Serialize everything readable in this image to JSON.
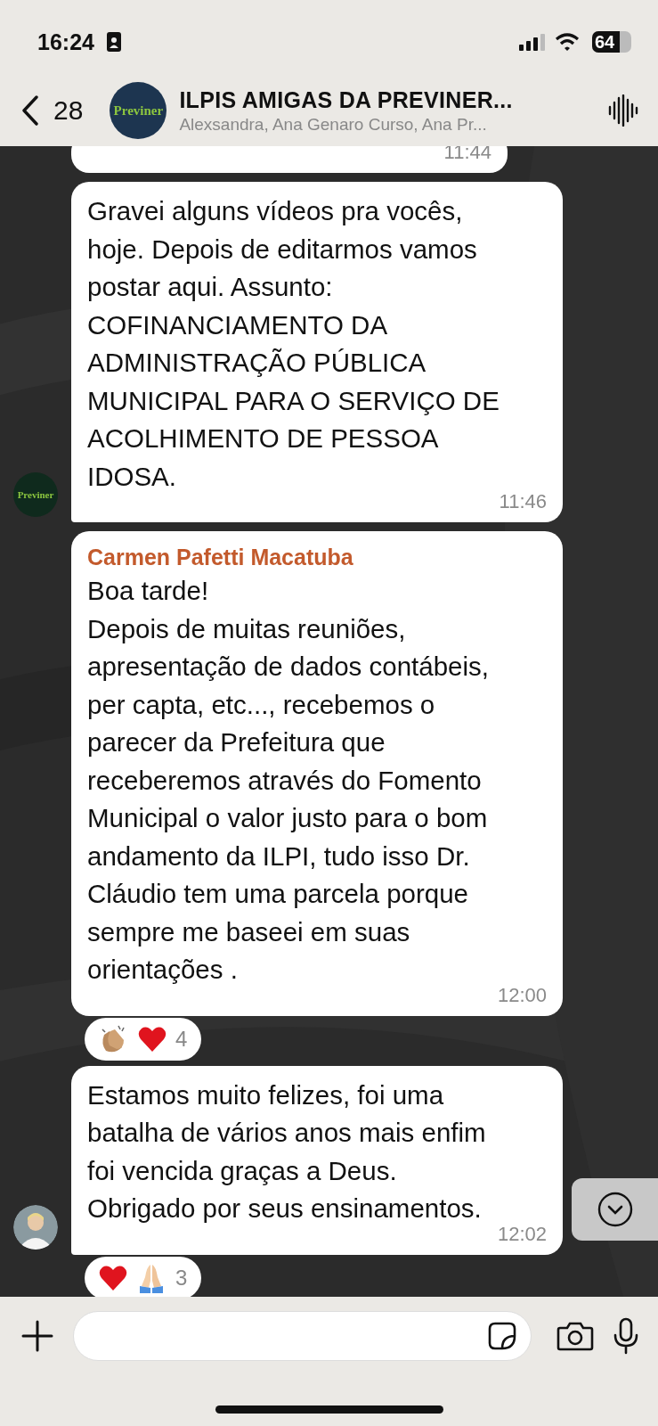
{
  "status_bar": {
    "time": "16:24",
    "battery": "64"
  },
  "header": {
    "back_count": "28",
    "avatar_text": "Previner",
    "title": "ILPIS AMIGAS DA PREVINER...",
    "subtitle": "Alexsandra, Ana Genaro Curso, Ana Pr..."
  },
  "messages": [
    {
      "time": "11:44"
    },
    {
      "lines": [
        "Gravei alguns vídeos pra vocês,",
        "hoje. Depois de editarmos vamos",
        "postar aqui. Assunto:",
        "COFINANCIAMENTO DA",
        "ADMINISTRAÇÃO PÚBLICA",
        "MUNICIPAL PARA O SERVIÇO DE",
        "ACOLHIMENTO DE PESSOA",
        "IDOSA."
      ],
      "time": "11:46",
      "avatar": {
        "kind": "logo",
        "text": "Previner"
      }
    },
    {
      "sender": "Carmen Pafetti Macatuba",
      "lines": [
        "Boa tarde!",
        "Depois de muitas reuniões,",
        "apresentação de dados contábeis,",
        "per capta, etc..., recebemos o",
        "parecer da Prefeitura que",
        "receberemos através do Fomento",
        "Municipal o valor justo para o bom",
        "andamento da ILPI,  tudo isso Dr.",
        "Cláudio  tem uma parcela porque",
        "sempre  me baseei em suas",
        "orientações ."
      ],
      "time": "12:00",
      "reactions": [
        {
          "kind": "clap"
        },
        {
          "kind": "heart"
        }
      ],
      "reaction_count": "4"
    },
    {
      "lines": [
        "Estamos muito felizes, foi uma",
        "batalha de vários anos mais enfim",
        "foi vencida graças a Deus.",
        "Obrigado por seus ensinamentos."
      ],
      "time": "12:02",
      "reactions": [
        {
          "kind": "heart"
        },
        {
          "kind": "pray"
        }
      ],
      "reaction_count": "3"
    }
  ]
}
